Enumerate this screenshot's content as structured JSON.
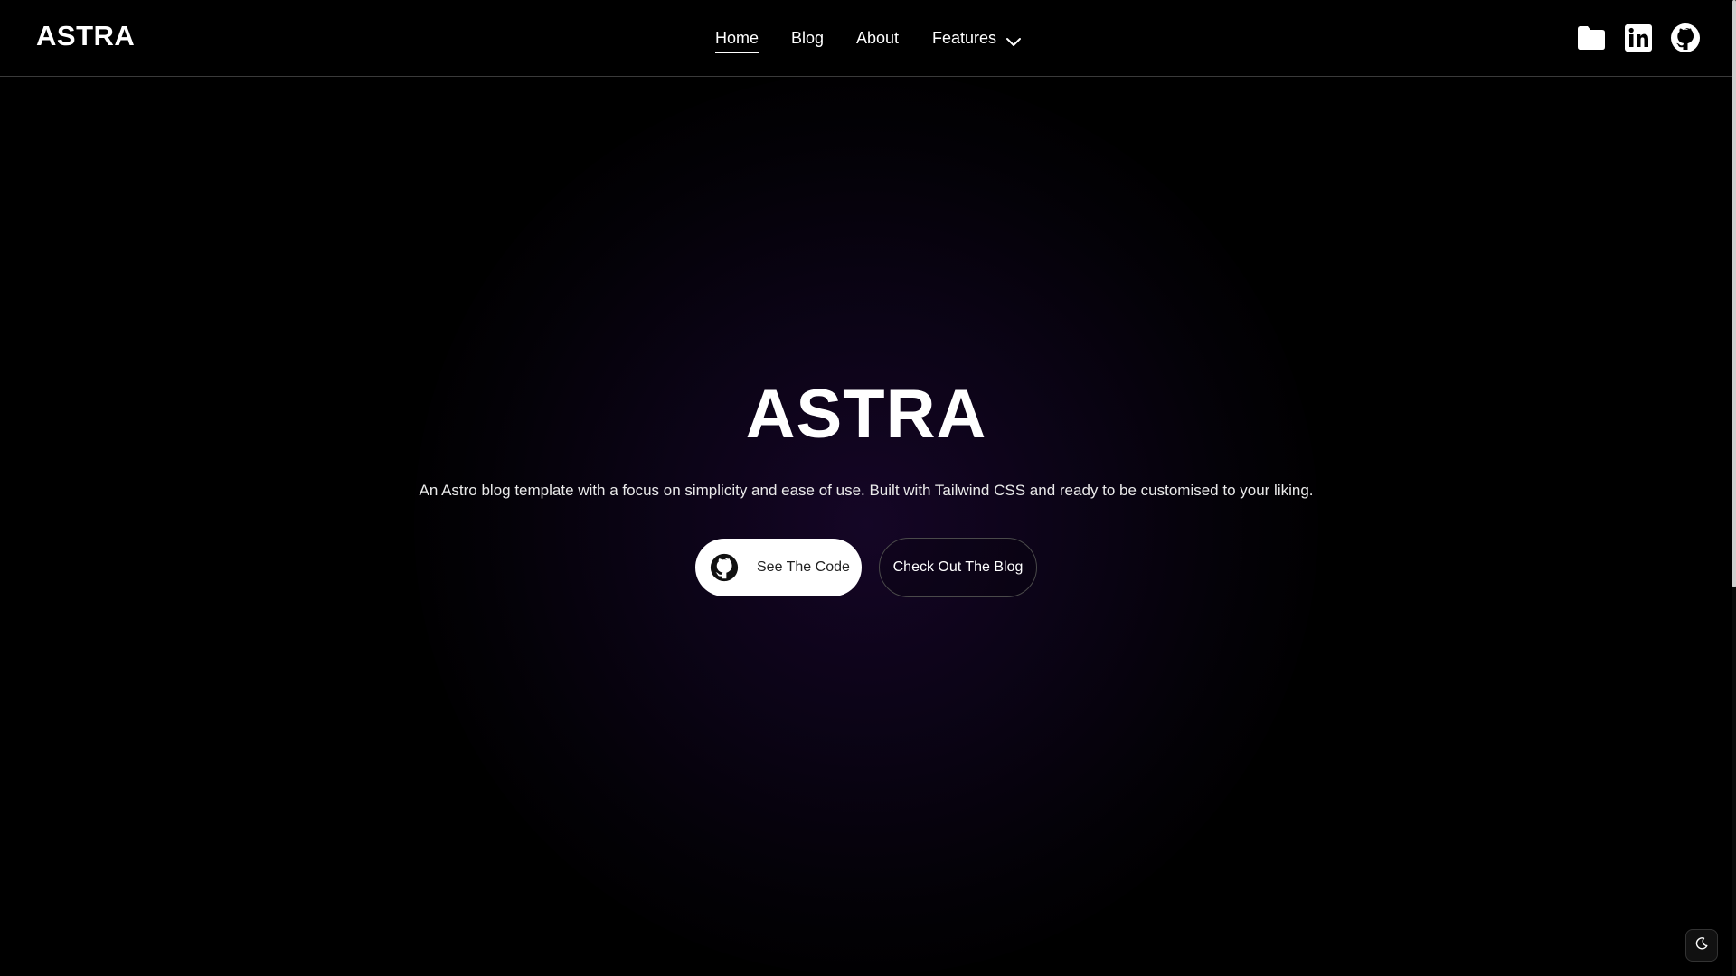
{
  "header": {
    "brand": "ASTRA",
    "nav": {
      "home": "Home",
      "blog": "Blog",
      "about": "About",
      "features": "Features",
      "active": "Home"
    },
    "social_icons": [
      "folder-icon",
      "linkedin-icon",
      "github-icon"
    ]
  },
  "hero": {
    "title": "ASTRA",
    "subtitle": "An Astro blog template with a focus on simplicity and ease of use. Built with Tailwind CSS and ready to be customised to your liking.",
    "primary_button": {
      "label": "See The Code",
      "icon": "github-icon"
    },
    "secondary_button": {
      "label": "Check Out The Blog"
    }
  },
  "theme_toggle": {
    "icon": "moon-icon",
    "mode": "dark"
  },
  "colors": {
    "background": "#000000",
    "text": "#ffffff",
    "glow": "#160628",
    "primary_button_bg": "#ffffff",
    "border": "#3a3a3a"
  }
}
